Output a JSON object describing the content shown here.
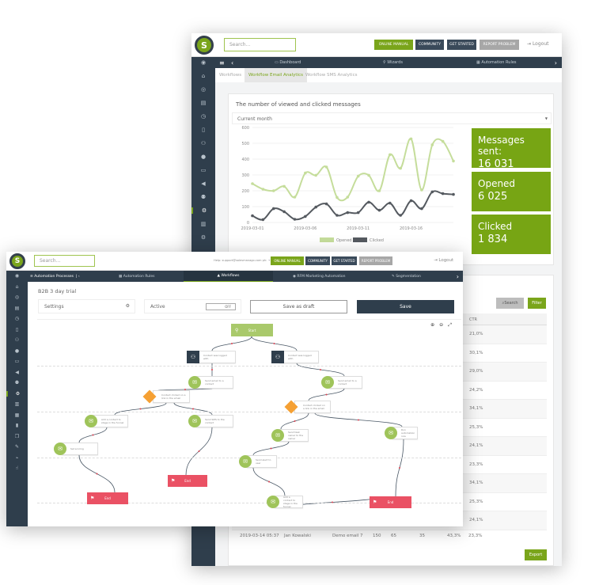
{
  "back": {
    "logo": "S",
    "search_placeholder": "Search...",
    "buttons": [
      "ONLINE MANUAL",
      "COMMUNITY",
      "GET STARTED",
      "REPORT PROBLEM"
    ],
    "logout": "Logout",
    "nav": [
      "Dashboard",
      "Wizards",
      "Automation Rules"
    ],
    "tabs": [
      "Workflows",
      "Workflow Email Analytics",
      "Workflow SMS Analytics"
    ],
    "panel_title": "The number of viewed and clicked messages",
    "period": "Current month",
    "stats": [
      {
        "label": "Messages sent:",
        "value": "16 031"
      },
      {
        "label": "Opened",
        "value": "6 025"
      },
      {
        "label": "Clicked",
        "value": "1 834"
      }
    ],
    "table": {
      "search_label": "Search",
      "filter_label": "Filter",
      "export_label": "Export",
      "ctr_header": "CTR",
      "ctr_values": [
        "21,0%",
        "30,1%",
        "29,0%",
        "24,2%",
        "34,1%",
        "25,3%",
        "24,1%",
        "23,3%",
        "34,1%",
        "25,3%",
        "24,1%"
      ],
      "last_row": [
        "2019-03-14 05:37",
        "Jan Kowalski",
        "Demo email 7",
        "150",
        "65",
        "35",
        "43,3%",
        "23,3%"
      ]
    }
  },
  "chart_data": {
    "type": "line",
    "title": "The number of viewed and clicked messages",
    "x": [
      "2019-03-01",
      "2019-03-02",
      "2019-03-03",
      "2019-03-04",
      "2019-03-05",
      "2019-03-06",
      "2019-03-07",
      "2019-03-08",
      "2019-03-09",
      "2019-03-10",
      "2019-03-11",
      "2019-03-12",
      "2019-03-13",
      "2019-03-14",
      "2019-03-15",
      "2019-03-16",
      "2019-03-17",
      "2019-03-18",
      "2019-03-19",
      "2019-03-20"
    ],
    "x_tick_labels": [
      "2019-03-01",
      "2019-03-06",
      "2019-03-11",
      "2019-03-16"
    ],
    "y_ticks": [
      0,
      100,
      200,
      300,
      400,
      500,
      600
    ],
    "ylim": [
      0,
      600
    ],
    "legend_position": "bottom",
    "series": [
      {
        "name": "Opened",
        "color": "#c5dd9b",
        "values": [
          245,
          210,
          200,
          228,
          160,
          312,
          298,
          350,
          158,
          160,
          292,
          298,
          200,
          428,
          342,
          528,
          205,
          490,
          512,
          388
        ]
      },
      {
        "name": "Clicked",
        "color": "#555a60",
        "values": [
          42,
          18,
          87,
          68,
          20,
          38,
          97,
          117,
          45,
          62,
          62,
          128,
          77,
          122,
          45,
          137,
          87,
          193,
          182,
          177
        ]
      }
    ]
  },
  "front": {
    "logo": "S",
    "search_placeholder": "Search...",
    "help": "Help: support@salesmanago.com ph: +1 855 395 0027",
    "buttons": [
      "ONLINE MANUAL",
      "COMMUNITY",
      "GET STARTED",
      "REPORT PROBLEM"
    ],
    "logout": "Logout",
    "nav_title": "Automation Processes",
    "nav": [
      "Automation Rules",
      "Workflows",
      "RFM Marketing Automation",
      "Segmentation"
    ],
    "page_title": "B2B 3 day trial",
    "settings_label": "Settings",
    "active_label": "Active",
    "toggle": "OFF",
    "save_draft": "Save as draft",
    "save": "Save",
    "nodes": [
      "Start",
      "Contact was logged with",
      "Contact was logged with",
      "Send email to a contact",
      "Send email to a contact",
      "Contact clicked on a link in the email",
      "Contact clicked on a link in the email",
      "Send SMS to the contact",
      "Add a contact to stage in the funnel",
      "Set scoring",
      "End",
      "End",
      "Send task owner to the owner",
      "Run automation rule",
      "Send alert to user",
      "Add a contact to stage in the funnel",
      "End"
    ]
  },
  "colors": {
    "accent": "#7aa51b",
    "nav": "#2f3e4c",
    "end": "#ea5164",
    "condition": "#f5a033",
    "action": "#9fc45a"
  }
}
